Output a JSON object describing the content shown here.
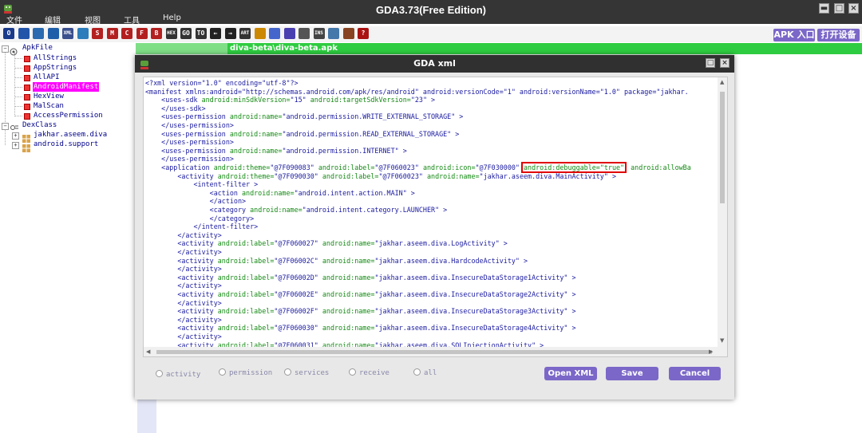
{
  "app": {
    "title": "GDA3.73(Free Edition)",
    "menu": [
      "文件",
      "编辑",
      "视图",
      "工具",
      "Help"
    ],
    "window_buttons": [
      "minimize-icon",
      "maximize-icon",
      "close-icon"
    ]
  },
  "toolbar": {
    "icons": [
      {
        "name": "O",
        "label": "O",
        "color": "#1a3a8a"
      },
      {
        "name": "save-icon",
        "label": "",
        "color": "#2255aa"
      },
      {
        "name": "search-icon",
        "label": "",
        "color": "#2a6ab0"
      },
      {
        "name": "link-icon",
        "label": "",
        "color": "#1f5faa"
      },
      {
        "name": "XML",
        "label": "XML",
        "color": "#3a4f8e"
      },
      {
        "name": "grid-icon",
        "label": "",
        "color": "#2c7dbb"
      },
      {
        "name": "S",
        "label": "S",
        "color": "#b32020"
      },
      {
        "name": "M",
        "label": "M",
        "color": "#b32020"
      },
      {
        "name": "C",
        "label": "C",
        "color": "#b32020"
      },
      {
        "name": "F",
        "label": "F",
        "color": "#b32020"
      },
      {
        "name": "B",
        "label": "B",
        "color": "#b32020"
      },
      {
        "name": "HEX",
        "label": "HEX",
        "color": "#333333"
      },
      {
        "name": "GO",
        "label": "GO",
        "color": "#333333"
      },
      {
        "name": "TO",
        "label": "TO",
        "color": "#333333"
      },
      {
        "name": "back-icon",
        "label": "←",
        "color": "#222222"
      },
      {
        "name": "forward-icon",
        "label": "→",
        "color": "#222222"
      },
      {
        "name": "ART",
        "label": "ART",
        "color": "#333333"
      },
      {
        "name": "shield-icon",
        "label": "",
        "color": "#cc8800"
      },
      {
        "name": "monitor-icon",
        "label": "",
        "color": "#4466cc"
      },
      {
        "name": "brush-icon",
        "label": "",
        "color": "#4a3fb0"
      },
      {
        "name": "doc-icon",
        "label": "",
        "color": "#555555"
      },
      {
        "name": "INS",
        "label": "INS",
        "color": "#444444"
      },
      {
        "name": "image-icon",
        "label": "",
        "color": "#4477aa"
      },
      {
        "name": "chart-icon",
        "label": "",
        "color": "#884422"
      },
      {
        "name": "help-icon",
        "label": "?",
        "color": "#aa1111"
      }
    ],
    "apk_entry": "APK 入口",
    "open_device": "打开设备"
  },
  "tree": {
    "root": "ApkFile",
    "items": [
      "AllStrings",
      "AppStrings",
      "AllAPI",
      "AndroidManifest",
      "HexView",
      "MalScan",
      "AccessPermission"
    ],
    "selected": "AndroidManifest",
    "dex_root": "DexClass",
    "dex_items": [
      "jakhar.aseem.diva",
      "android.support"
    ]
  },
  "path": {
    "text": "diva-beta\\diva-beta.apk"
  },
  "dialog": {
    "title": "GDA xml",
    "radios": [
      "activity",
      "permission",
      "services",
      "receive",
      "all"
    ],
    "buttons": [
      "Open XML",
      "Save",
      "Cancel"
    ],
    "xml_lines": [
      [
        {
          "t": "",
          "c": ""
        },
        {
          "t": "<?xml version=\"1.0\" encoding=\"utf-8\"?>",
          "c": ""
        }
      ],
      [
        {
          "t": "<manifest xmlns:android=\"http://schemas.android.com/apk/res/android\" android:versionCode=\"1\" android:versionName=\"1.0\" package=\"jakhar.",
          "c": ""
        }
      ],
      [
        {
          "t": "    <uses-sdk ",
          "c": ""
        },
        {
          "t": "android:minSdkVersion=",
          "c": "k"
        },
        {
          "t": "\"15\" ",
          "c": ""
        },
        {
          "t": "android:targetSdkVersion=",
          "c": "k"
        },
        {
          "t": "\"23\" >",
          "c": ""
        }
      ],
      [
        {
          "t": "    </uses-sdk>",
          "c": ""
        }
      ],
      [
        {
          "t": "    <uses-permission ",
          "c": ""
        },
        {
          "t": "android:name=",
          "c": "k"
        },
        {
          "t": "\"android.permission.WRITE_EXTERNAL_STORAGE\" >",
          "c": ""
        }
      ],
      [
        {
          "t": "    </uses-permission>",
          "c": ""
        }
      ],
      [
        {
          "t": "    <uses-permission ",
          "c": ""
        },
        {
          "t": "android:name=",
          "c": "k"
        },
        {
          "t": "\"android.permission.READ_EXTERNAL_STORAGE\" >",
          "c": ""
        }
      ],
      [
        {
          "t": "    </uses-permission>",
          "c": ""
        }
      ],
      [
        {
          "t": "    <uses-permission ",
          "c": ""
        },
        {
          "t": "android:name=",
          "c": "k"
        },
        {
          "t": "\"android.permission.INTERNET\" >",
          "c": ""
        }
      ],
      [
        {
          "t": "    </uses-permission>",
          "c": ""
        }
      ],
      [
        {
          "t": "    <application ",
          "c": ""
        },
        {
          "t": "android:theme=",
          "c": "k"
        },
        {
          "t": "\"@7F090083\" ",
          "c": ""
        },
        {
          "t": "android:label=",
          "c": "k"
        },
        {
          "t": "\"@7F060023\" ",
          "c": ""
        },
        {
          "t": "android:icon=",
          "c": "k"
        },
        {
          "t": "\"@7F030000\" ",
          "c": ""
        },
        {
          "t": "android:debuggable=\"true\"",
          "c": "k hl"
        },
        {
          "t": " ",
          "c": ""
        },
        {
          "t": "android:allowBa",
          "c": "k"
        }
      ],
      [
        {
          "t": "        <activity ",
          "c": ""
        },
        {
          "t": "android:theme=",
          "c": "k"
        },
        {
          "t": "\"@7F090030\" ",
          "c": ""
        },
        {
          "t": "android:label=",
          "c": "k"
        },
        {
          "t": "\"@7F060023\" ",
          "c": ""
        },
        {
          "t": "android:name=",
          "c": "k"
        },
        {
          "t": "\"jakhar.aseem.diva.MainActivity\" >",
          "c": ""
        }
      ],
      [
        {
          "t": "            <intent-filter >",
          "c": ""
        }
      ],
      [
        {
          "t": "                <action ",
          "c": ""
        },
        {
          "t": "android:name=",
          "c": "k"
        },
        {
          "t": "\"android.intent.action.MAIN\" >",
          "c": ""
        }
      ],
      [
        {
          "t": "                </action>",
          "c": ""
        }
      ],
      [
        {
          "t": "                <category ",
          "c": ""
        },
        {
          "t": "android:name=",
          "c": "k"
        },
        {
          "t": "\"android.intent.category.LAUNCHER\" >",
          "c": ""
        }
      ],
      [
        {
          "t": "                </category>",
          "c": ""
        }
      ],
      [
        {
          "t": "            </intent-filter>",
          "c": ""
        }
      ],
      [
        {
          "t": "        </activity>",
          "c": ""
        }
      ],
      [
        {
          "t": "        <activity ",
          "c": ""
        },
        {
          "t": "android:label=",
          "c": "k"
        },
        {
          "t": "\"@7F060027\" ",
          "c": ""
        },
        {
          "t": "android:name=",
          "c": "k"
        },
        {
          "t": "\"jakhar.aseem.diva.LogActivity\" >",
          "c": ""
        }
      ],
      [
        {
          "t": "        </activity>",
          "c": ""
        }
      ],
      [
        {
          "t": "        <activity ",
          "c": ""
        },
        {
          "t": "android:label=",
          "c": "k"
        },
        {
          "t": "\"@7F06002C\" ",
          "c": ""
        },
        {
          "t": "android:name=",
          "c": "k"
        },
        {
          "t": "\"jakhar.aseem.diva.HardcodeActivity\" >",
          "c": ""
        }
      ],
      [
        {
          "t": "        </activity>",
          "c": ""
        }
      ],
      [
        {
          "t": "        <activity ",
          "c": ""
        },
        {
          "t": "android:label=",
          "c": "k"
        },
        {
          "t": "\"@7F06002D\" ",
          "c": ""
        },
        {
          "t": "android:name=",
          "c": "k"
        },
        {
          "t": "\"jakhar.aseem.diva.InsecureDataStorage1Activity\" >",
          "c": ""
        }
      ],
      [
        {
          "t": "        </activity>",
          "c": ""
        }
      ],
      [
        {
          "t": "        <activity ",
          "c": ""
        },
        {
          "t": "android:label=",
          "c": "k"
        },
        {
          "t": "\"@7F06002E\" ",
          "c": ""
        },
        {
          "t": "android:name=",
          "c": "k"
        },
        {
          "t": "\"jakhar.aseem.diva.InsecureDataStorage2Activity\" >",
          "c": ""
        }
      ],
      [
        {
          "t": "        </activity>",
          "c": ""
        }
      ],
      [
        {
          "t": "        <activity ",
          "c": ""
        },
        {
          "t": "android:label=",
          "c": "k"
        },
        {
          "t": "\"@7F06002F\" ",
          "c": ""
        },
        {
          "t": "android:name=",
          "c": "k"
        },
        {
          "t": "\"jakhar.aseem.diva.InsecureDataStorage3Activity\" >",
          "c": ""
        }
      ],
      [
        {
          "t": "        </activity>",
          "c": ""
        }
      ],
      [
        {
          "t": "        <activity ",
          "c": ""
        },
        {
          "t": "android:label=",
          "c": "k"
        },
        {
          "t": "\"@7F060030\" ",
          "c": ""
        },
        {
          "t": "android:name=",
          "c": "k"
        },
        {
          "t": "\"jakhar.aseem.diva.InsecureDataStorage4Activity\" >",
          "c": ""
        }
      ],
      [
        {
          "t": "        </activity>",
          "c": ""
        }
      ],
      [
        {
          "t": "        <activity ",
          "c": ""
        },
        {
          "t": "android:label=",
          "c": "k"
        },
        {
          "t": "\"@7F060031\" ",
          "c": ""
        },
        {
          "t": "android:name=",
          "c": "k"
        },
        {
          "t": "\"jakhar.aseem.diva.SQLInjectionActivity\" >",
          "c": ""
        }
      ]
    ]
  },
  "colors": {
    "accent_button": "#7b67c8",
    "path_bar": "#2ecc40",
    "selected_item": "#ff00ff",
    "highlight_box": "#e00000"
  }
}
